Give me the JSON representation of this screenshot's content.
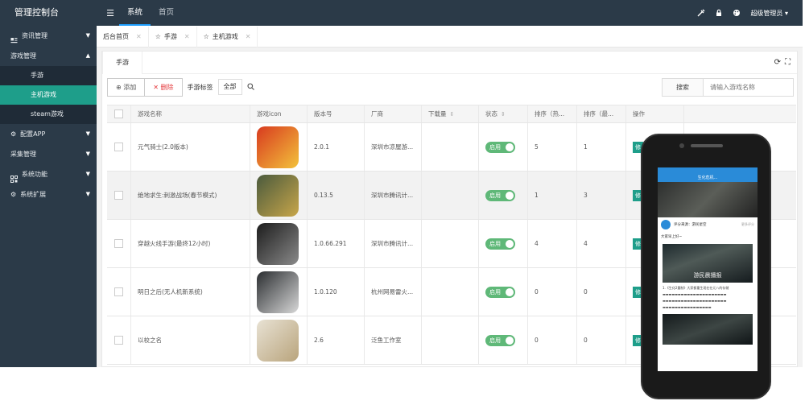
{
  "header": {
    "title": "管理控制台",
    "nav": [
      "系统",
      "首页"
    ],
    "user": "超级管理员"
  },
  "sidebar": {
    "items": [
      {
        "label": "资讯管理",
        "icon": "news-icon",
        "expanded": false
      },
      {
        "label": "游戏管理",
        "icon": "",
        "expanded": true,
        "children": [
          "手游",
          "主机游戏",
          "steam游戏"
        ],
        "active_child": 1
      },
      {
        "label": "配置APP",
        "icon": "gear-icon",
        "expanded": false
      },
      {
        "label": "采集管理",
        "icon": "",
        "expanded": false
      },
      {
        "label": "系统功能",
        "icon": "grid-icon",
        "expanded": false
      },
      {
        "label": "系统扩展",
        "icon": "gear-icon",
        "expanded": false
      }
    ]
  },
  "tabs": [
    "后台首页",
    "手游",
    "主机游戏"
  ],
  "panel": {
    "subtab": "手游",
    "toolbar": {
      "add_label": "添加",
      "delete_label": "删除",
      "tags_label": "手游标签",
      "all_label": "全部",
      "search_label": "搜索",
      "search_placeholder": "请输入游戏名称"
    }
  },
  "table": {
    "columns": [
      "游戏名称",
      "游戏icon",
      "版本号",
      "厂商",
      "下载量",
      "状态",
      "排序（热...",
      "排序（最...",
      "操作"
    ],
    "rows": [
      {
        "name": "元气骑士(2.0版本)",
        "version": "2.0.1",
        "vendor": "深圳市凉屋游...",
        "downloads": "",
        "status": "启用",
        "sort_hot": "5",
        "sort_new": "1",
        "action": "修",
        "icon_colors": [
          "#d83a1f",
          "#f3c23b"
        ]
      },
      {
        "name": "绝地求生:刺激战场(春节模式)",
        "version": "0.13.5",
        "vendor": "深圳市腾讯计...",
        "downloads": "",
        "status": "启用",
        "sort_hot": "1",
        "sort_new": "3",
        "action": "修",
        "icon_colors": [
          "#4a5a3d",
          "#c8a64a"
        ]
      },
      {
        "name": "穿越火线手游(最终12小时)",
        "version": "1.0.66.291",
        "vendor": "深圳市腾讯计...",
        "downloads": "",
        "status": "启用",
        "sort_hot": "4",
        "sort_new": "4",
        "action": "修",
        "icon_colors": [
          "#1c1c1c",
          "#8a8a8a"
        ]
      },
      {
        "name": "明日之后(无人机新系统)",
        "version": "1.0.120",
        "vendor": "杭州网易雷火...",
        "downloads": "",
        "status": "启用",
        "sort_hot": "0",
        "sort_new": "0",
        "action": "修",
        "icon_colors": [
          "#2a2d30",
          "#d8d8d8"
        ]
      },
      {
        "name": "以校之名",
        "version": "2.6",
        "vendor": "泛鱼工作室",
        "downloads": "",
        "status": "启用",
        "sort_hot": "0",
        "sort_new": "0",
        "action": "修",
        "icon_colors": [
          "#e8e2d4",
          "#b9a47c"
        ]
      }
    ]
  },
  "phone": {
    "app_title": "生化危机...",
    "score_label": "评分来源：游民星空",
    "more_label": "更多评分",
    "greeting": "大家早上好~",
    "image_caption": "游民晨播报",
    "section_title": "1.《生化2重制》大家都重生现在在元八的存储"
  },
  "colors": {
    "header_bg": "#2b3a48",
    "accent": "#1e9e8a",
    "switch_on": "#5fb878"
  }
}
